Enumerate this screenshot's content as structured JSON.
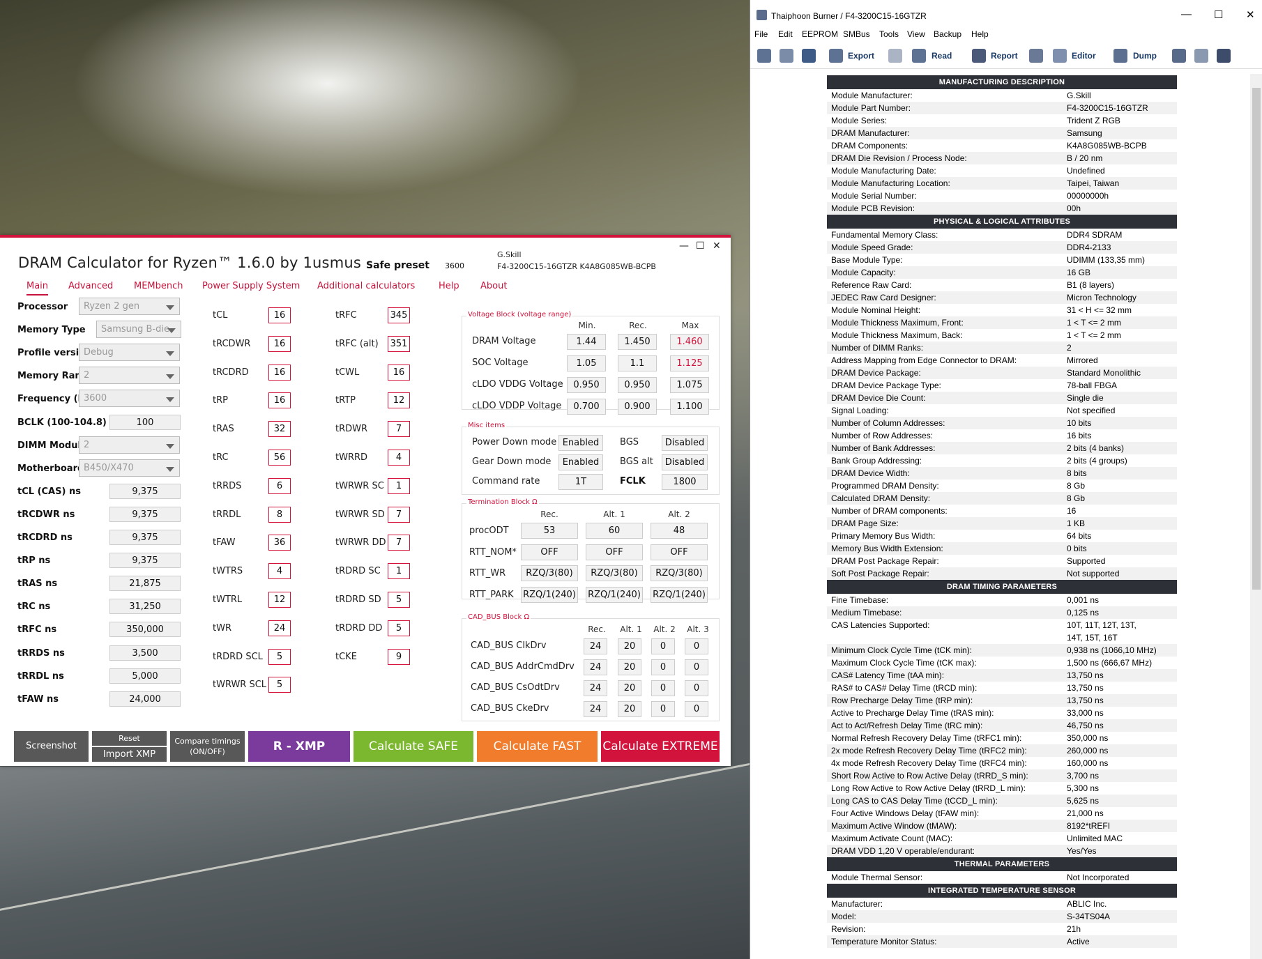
{
  "dram_calc": {
    "title": "DRAM Calculator for Ryzen™ 1.6.0 by 1usmus",
    "preset_label": "Safe preset",
    "preset_freq": "3600",
    "module_line1": "G.Skill",
    "module_line2": "F4-3200C15-16GTZR K4A8G085WB-BCPB",
    "min_icon": "—",
    "max_icon": "☐",
    "close_icon": "✕",
    "tabs": [
      "Main",
      "Advanced",
      "MEMbench",
      "Power Supply System",
      "Additional calculators",
      "Help",
      "About"
    ],
    "left": [
      {
        "label": "Processor",
        "value": "Ryzen 2 gen",
        "kind": "select"
      },
      {
        "label": "Memory Type",
        "value": "Samsung B-die",
        "kind": "select"
      },
      {
        "label": "Profile version",
        "value": "Debug",
        "kind": "select"
      },
      {
        "label": "Memory Rank",
        "value": "2",
        "kind": "select"
      },
      {
        "label": "Frequency (MT/s)",
        "value": "3600",
        "kind": "select"
      },
      {
        "label": "BCLK (100-104.8)",
        "value": "100",
        "kind": "input"
      },
      {
        "label": "DIMM Modules",
        "value": "2",
        "kind": "select"
      },
      {
        "label": "Motherboard",
        "value": "B450/X470",
        "kind": "select"
      },
      {
        "label": "tCL (CAS) ns",
        "value": "9,375",
        "kind": "input"
      },
      {
        "label": "tRCDWR ns",
        "value": "9,375",
        "kind": "input"
      },
      {
        "label": "tRCDRD ns",
        "value": "9,375",
        "kind": "input"
      },
      {
        "label": "tRP ns",
        "value": "9,375",
        "kind": "input"
      },
      {
        "label": "tRAS ns",
        "value": "21,875",
        "kind": "input"
      },
      {
        "label": "tRC ns",
        "value": "31,250",
        "kind": "input"
      },
      {
        "label": "tRFC ns",
        "value": "350,000",
        "kind": "input"
      },
      {
        "label": "tRRDS ns",
        "value": "3,500",
        "kind": "input"
      },
      {
        "label": "tRRDL ns",
        "value": "5,000",
        "kind": "input"
      },
      {
        "label": "tFAW ns",
        "value": "24,000",
        "kind": "input"
      }
    ],
    "timings_col1": [
      {
        "label": "tCL",
        "value": "16"
      },
      {
        "label": "tRCDWR",
        "value": "16"
      },
      {
        "label": "tRCDRD",
        "value": "16"
      },
      {
        "label": "tRP",
        "value": "16"
      },
      {
        "label": "tRAS",
        "value": "32"
      },
      {
        "label": "tRC",
        "value": "56"
      },
      {
        "label": "tRRDS",
        "value": "6"
      },
      {
        "label": "tRRDL",
        "value": "8"
      },
      {
        "label": "tFAW",
        "value": "36"
      },
      {
        "label": "tWTRS",
        "value": "4"
      },
      {
        "label": "tWTRL",
        "value": "12"
      },
      {
        "label": "tWR",
        "value": "24"
      },
      {
        "label": "tRDRD SCL",
        "value": "5"
      },
      {
        "label": "tWRWR SCL",
        "value": "5"
      }
    ],
    "timings_col2": [
      {
        "label": "tRFC",
        "value": "345"
      },
      {
        "label": "tRFC (alt)",
        "value": "351"
      },
      {
        "label": "tCWL",
        "value": "16"
      },
      {
        "label": "tRTP",
        "value": "12"
      },
      {
        "label": "tRDWR",
        "value": "7"
      },
      {
        "label": "tWRRD",
        "value": "4"
      },
      {
        "label": "tWRWR SC",
        "value": "1"
      },
      {
        "label": "tWRWR SD",
        "value": "7"
      },
      {
        "label": "tWRWR DD",
        "value": "7"
      },
      {
        "label": "tRDRD SC",
        "value": "1"
      },
      {
        "label": "tRDRD SD",
        "value": "5"
      },
      {
        "label": "tRDRD DD",
        "value": "5"
      },
      {
        "label": "tCKE",
        "value": "9"
      }
    ],
    "voltage": {
      "title": "Voltage Block (voltage range)",
      "headers": [
        "Min.",
        "Rec.",
        "Max"
      ],
      "rows": [
        {
          "label": "DRAM Voltage",
          "values": [
            "1.44",
            "1.450",
            "1.460"
          ]
        },
        {
          "label": "SOC Voltage",
          "values": [
            "1.05",
            "1.1",
            "1.125"
          ]
        },
        {
          "label": "cLDO VDDG Voltage",
          "values": [
            "0.950",
            "0.950",
            "1.075"
          ]
        },
        {
          "label": "cLDO VDDP Voltage",
          "values": [
            "0.700",
            "0.900",
            "1.100"
          ]
        }
      ],
      "max_red_rows": [
        0,
        1
      ],
      "accent": "#d2143c"
    },
    "misc": {
      "title": "Misc items",
      "power_down_label": "Power Down mode",
      "power_down_value": "Enabled",
      "bgs_label": "BGS",
      "bgs_value": "Disabled",
      "gear_down_label": "Gear Down mode",
      "gear_down_value": "Enabled",
      "bgs_alt_label": "BGS alt",
      "bgs_alt_value": "Disabled",
      "cmd_rate_label": "Command rate",
      "cmd_rate_value": "1T",
      "fclk_label": "FCLK",
      "fclk_value": "1800"
    },
    "termination": {
      "title": "Termination Block Ω",
      "headers": [
        "Rec.",
        "Alt. 1",
        "Alt. 2"
      ],
      "rows": [
        {
          "label": "procODT",
          "values": [
            "53",
            "60",
            "48"
          ]
        },
        {
          "label": "RTT_NOM*",
          "values": [
            "OFF",
            "OFF",
            "OFF"
          ]
        },
        {
          "label": "RTT_WR",
          "values": [
            "RZQ/3(80)",
            "RZQ/3(80)",
            "RZQ/3(80)"
          ]
        },
        {
          "label": "RTT_PARK",
          "values": [
            "RZQ/1(240)",
            "RZQ/1(240)",
            "RZQ/1(240)"
          ]
        }
      ]
    },
    "cad_bus": {
      "title": "CAD_BUS Block Ω",
      "headers": [
        "Rec.",
        "Alt. 1",
        "Alt. 2",
        "Alt. 3"
      ],
      "rows": [
        {
          "label": "CAD_BUS ClkDrv",
          "values": [
            "24",
            "20",
            "0",
            "0"
          ]
        },
        {
          "label": "CAD_BUS AddrCmdDrv",
          "values": [
            "24",
            "20",
            "0",
            "0"
          ]
        },
        {
          "label": "CAD_BUS CsOdtDrv",
          "values": [
            "24",
            "20",
            "0",
            "0"
          ]
        },
        {
          "label": "CAD_BUS CkeDrv",
          "values": [
            "24",
            "20",
            "0",
            "0"
          ]
        }
      ]
    },
    "buttons": {
      "screenshot": "Screenshot",
      "reset": "Reset",
      "import_xmp": "Import XMP",
      "compare": "Compare timings\n(ON/OFF)",
      "rxmp": "R - XMP",
      "safe": "Calculate SAFE",
      "fast": "Calculate FAST",
      "extreme": "Calculate EXTREME"
    },
    "colors": {
      "rxmp": "#7a3b9c",
      "safe": "#7cb82f",
      "fast": "#f07c2c",
      "extreme": "#d2143c",
      "grey": "#585858"
    }
  },
  "thaiphoon": {
    "title": "Thaiphoon Burner / F4-3200C15-16GTZR",
    "min_icon": "—",
    "max_icon": "☐",
    "close_icon": "✕",
    "menu": [
      "File",
      "Edit",
      "EEPROM",
      "SMBus",
      "Tools",
      "View",
      "Backup",
      "Help"
    ],
    "toolbar": {
      "export": "Export",
      "read": "Read",
      "report": "Report",
      "editor": "Editor",
      "dump": "Dump"
    },
    "sections": [
      {
        "title": "MANUFACTURING DESCRIPTION",
        "rows": [
          [
            "Module Manufacturer:",
            "G.Skill"
          ],
          [
            "Module Part Number:",
            "F4-3200C15-16GTZR"
          ],
          [
            "Module Series:",
            "Trident Z RGB"
          ],
          [
            "DRAM Manufacturer:",
            "Samsung"
          ],
          [
            "DRAM Components:",
            "K4A8G085WB-BCPB"
          ],
          [
            "DRAM Die Revision / Process Node:",
            "B / 20 nm"
          ],
          [
            "Module Manufacturing Date:",
            "Undefined"
          ],
          [
            "Module Manufacturing Location:",
            "Taipei, Taiwan"
          ],
          [
            "Module Serial Number:",
            "00000000h"
          ],
          [
            "Module PCB Revision:",
            "00h"
          ]
        ]
      },
      {
        "title": "PHYSICAL & LOGICAL ATTRIBUTES",
        "rows": [
          [
            "Fundamental Memory Class:",
            "DDR4 SDRAM"
          ],
          [
            "Module Speed Grade:",
            "DDR4-2133"
          ],
          [
            "Base Module Type:",
            "UDIMM (133,35 mm)"
          ],
          [
            "Module Capacity:",
            "16 GB"
          ],
          [
            "Reference Raw Card:",
            "B1 (8 layers)"
          ],
          [
            "JEDEC Raw Card Designer:",
            "Micron Technology"
          ],
          [
            "Module Nominal Height:",
            "31 < H <= 32 mm"
          ],
          [
            "Module Thickness Maximum, Front:",
            "1 < T <= 2 mm"
          ],
          [
            "Module Thickness Maximum, Back:",
            "1 < T <= 2 mm"
          ],
          [
            "Number of DIMM Ranks:",
            "2"
          ],
          [
            "Address Mapping from Edge Connector to DRAM:",
            "Mirrored"
          ],
          [
            "DRAM Device Package:",
            "Standard Monolithic"
          ],
          [
            "DRAM Device Package Type:",
            "78-ball FBGA"
          ],
          [
            "DRAM Device Die Count:",
            "Single die"
          ],
          [
            "Signal Loading:",
            "Not specified"
          ],
          [
            "Number of Column Addresses:",
            "10 bits"
          ],
          [
            "Number of Row Addresses:",
            "16 bits"
          ],
          [
            "Number of Bank Addresses:",
            "2 bits (4 banks)"
          ],
          [
            "Bank Group Addressing:",
            "2 bits (4 groups)"
          ],
          [
            "DRAM Device Width:",
            "8 bits"
          ],
          [
            "Programmed DRAM Density:",
            "8 Gb"
          ],
          [
            "Calculated DRAM Density:",
            "8 Gb"
          ],
          [
            "Number of DRAM components:",
            "16"
          ],
          [
            "DRAM Page Size:",
            "1 KB"
          ],
          [
            "Primary Memory Bus Width:",
            "64 bits"
          ],
          [
            "Memory Bus Width Extension:",
            "0 bits"
          ],
          [
            "DRAM Post Package Repair:",
            "Supported"
          ],
          [
            "Soft Post Package Repair:",
            "Not supported"
          ]
        ]
      },
      {
        "title": "DRAM TIMING PARAMETERS",
        "rows": [
          [
            "Fine Timebase:",
            "0,001 ns"
          ],
          [
            "Medium Timebase:",
            "0,125 ns"
          ],
          [
            "CAS Latencies Supported:",
            "10T, 11T, 12T, 13T,\n14T, 15T, 16T"
          ],
          [
            "Minimum Clock Cycle Time (tCK min):",
            "0,938 ns (1066,10 MHz)"
          ],
          [
            "Maximum Clock Cycle Time (tCK max):",
            "1,500 ns (666,67 MHz)"
          ],
          [
            "CAS# Latency Time (tAA min):",
            "13,750 ns"
          ],
          [
            "RAS# to CAS# Delay Time (tRCD min):",
            "13,750 ns"
          ],
          [
            "Row Precharge Delay Time (tRP min):",
            "13,750 ns"
          ],
          [
            "Active to Precharge Delay Time (tRAS min):",
            "33,000 ns"
          ],
          [
            "Act to Act/Refresh Delay Time (tRC min):",
            "46,750 ns"
          ],
          [
            "Normal Refresh Recovery Delay Time (tRFC1 min):",
            "350,000 ns"
          ],
          [
            "2x mode Refresh Recovery Delay Time (tRFC2 min):",
            "260,000 ns"
          ],
          [
            "4x mode Refresh Recovery Delay Time (tRFC4 min):",
            "160,000 ns"
          ],
          [
            "Short Row Active to Row Active Delay (tRRD_S min):",
            "3,700 ns"
          ],
          [
            "Long Row Active to Row Active Delay (tRRD_L min):",
            "5,300 ns"
          ],
          [
            "Long CAS to CAS Delay Time (tCCD_L min):",
            "5,625 ns"
          ],
          [
            "Four Active Windows Delay (tFAW min):",
            "21,000 ns"
          ],
          [
            "Maximum Active Window (tMAW):",
            "8192*tREFI"
          ],
          [
            "Maximum Activate Count (MAC):",
            "Unlimited MAC"
          ],
          [
            "DRAM VDD 1,20 V operable/endurant:",
            "Yes/Yes"
          ]
        ]
      },
      {
        "title": "THERMAL PARAMETERS",
        "rows": [
          [
            "Module Thermal Sensor:",
            "Not Incorporated"
          ]
        ]
      },
      {
        "title": "INTEGRATED TEMPERATURE SENSOR",
        "rows": [
          [
            "Manufacturer:",
            "ABLIC Inc."
          ],
          [
            "Model:",
            "S-34TS04A"
          ],
          [
            "Revision:",
            "21h"
          ],
          [
            "Temperature Monitor Status:",
            "Active"
          ]
        ]
      }
    ]
  }
}
